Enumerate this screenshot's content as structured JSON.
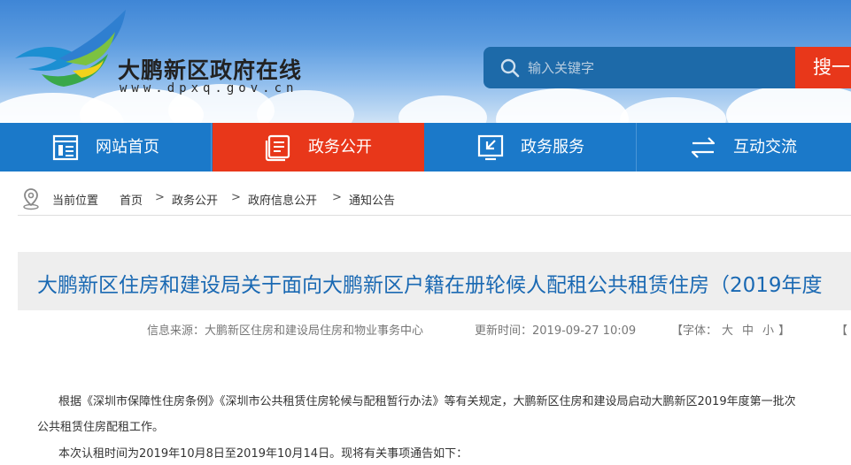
{
  "header": {
    "site_name": "大鹏新区政府在线",
    "site_url": "www.dpxq.gov.cn",
    "search": {
      "placeholder": "输入关键字",
      "button_label": "搜一下"
    },
    "colors": {
      "nav_bg": "#1b79c9",
      "active_nav": "#e8371a",
      "search_bg": "#1d6aa9"
    }
  },
  "nav": {
    "items": [
      {
        "label": "网站首页",
        "icon": "home-icon"
      },
      {
        "label": "政务公开",
        "icon": "document-icon"
      },
      {
        "label": "政务服务",
        "icon": "service-icon"
      },
      {
        "label": "互动交流",
        "icon": "exchange-icon"
      }
    ]
  },
  "breadcrumb": {
    "prefix": "当前位置",
    "items": [
      "首页",
      "政务公开",
      "政府信息公开",
      "通知公告"
    ],
    "separator": ">"
  },
  "article": {
    "title": "大鹏新区住房和建设局关于面向大鹏新区户籍在册轮候人配租公共租赁住房（2019年度",
    "source_label": "信息来源：大鹏新区住房和建设局住房和物业事务中心",
    "updated_label": "更新时间：2019-09-27 10:09",
    "font_size": {
      "prefix": "【字体：",
      "large": "大",
      "medium": "中",
      "small": "小",
      "suffix": "】"
    },
    "extra_bracket": "【",
    "paragraphs": [
      "根据《深圳市保障性住房条例》《深圳市公共租赁住房轮候与配租暂行办法》等有关规定，大鹏新区住房和建设局启动大鹏新区2019年度第一批次",
      "公共租赁住房配租工作。",
      "本次认租时间为2019年10月8日至2019年10月14日。现将有关事项通告如下："
    ]
  }
}
